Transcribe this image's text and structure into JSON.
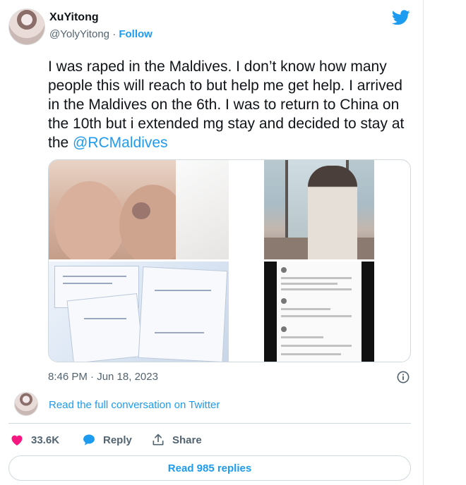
{
  "user": {
    "display_name": "XuYitong",
    "handle": "@YolyYitong",
    "separator": "·",
    "follow_label": "Follow"
  },
  "tweet": {
    "text_before": "I was raped in the Maldives. I don’t know how many people this will reach to but help me get help. I arrived in the Maldives on the 6th. I was to return to China on the 10th but i extended mg stay and decided to stay at the ",
    "mention": "@RCMaldives",
    "timestamp": "8:46 PM · Jun 18, 2023"
  },
  "media": {
    "count": 4,
    "items": [
      {
        "id": "photo-knees",
        "icon": "photo"
      },
      {
        "id": "photo-mirror",
        "icon": "photo"
      },
      {
        "id": "photo-documents",
        "icon": "photo"
      },
      {
        "id": "photo-phone-screen",
        "icon": "photo"
      }
    ]
  },
  "conversation": {
    "link_label": "Read the full conversation on Twitter"
  },
  "actions": {
    "like_count": "33.6K",
    "reply_label": "Reply",
    "share_label": "Share"
  },
  "read_replies_label": "Read 985 replies",
  "colors": {
    "accent": "#1d9bf0",
    "like": "#f91880",
    "text": "#0f1419",
    "muted": "#536471",
    "border": "#cfd9de"
  },
  "icons": {
    "brand": "twitter-bird-icon",
    "info": "info-icon",
    "like": "heart-icon",
    "reply": "speech-bubble-icon",
    "share": "share-upload-icon"
  }
}
